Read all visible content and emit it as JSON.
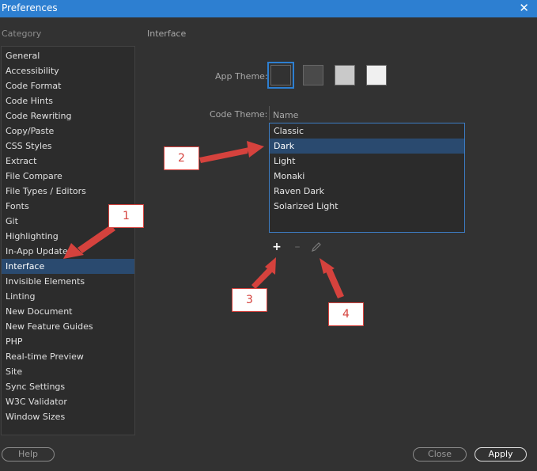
{
  "window": {
    "title": "Preferences"
  },
  "sidebar": {
    "label": "Category",
    "items": [
      "General",
      "Accessibility",
      "Code Format",
      "Code Hints",
      "Code Rewriting",
      "Copy/Paste",
      "CSS Styles",
      "Extract",
      "File Compare",
      "File Types / Editors",
      "Fonts",
      "Git",
      "Highlighting",
      "In-App Updates",
      "Interface",
      "Invisible Elements",
      "Linting",
      "New Document",
      "New Feature Guides",
      "PHP",
      "Real-time Preview",
      "Site",
      "Sync Settings",
      "W3C Validator",
      "Window Sizes"
    ],
    "selected": "Interface"
  },
  "panel": {
    "title": "Interface",
    "app_theme_label": "App Theme:",
    "app_theme_swatches": [
      "#323232",
      "#4a4a4a",
      "#c9c9c9",
      "#f0f0f0"
    ],
    "selected_swatch": 0,
    "code_theme_label": "Code Theme:",
    "list_header": "Name",
    "code_themes": [
      "Classic",
      "Dark",
      "Light",
      "Monaki",
      "Raven Dark",
      "Solarized Light"
    ],
    "selected_code_theme": "Dark",
    "icons": {
      "add": "plus-icon",
      "remove": "minus-icon",
      "edit": "pencil-icon"
    }
  },
  "annotations": [
    "1",
    "2",
    "3",
    "4"
  ],
  "buttons": {
    "help": "Help",
    "close": "Close",
    "apply": "Apply"
  },
  "colors": {
    "titlebar": "#2d7fd1",
    "selection": "#2a4a6f",
    "annotation": "#d5423d"
  }
}
